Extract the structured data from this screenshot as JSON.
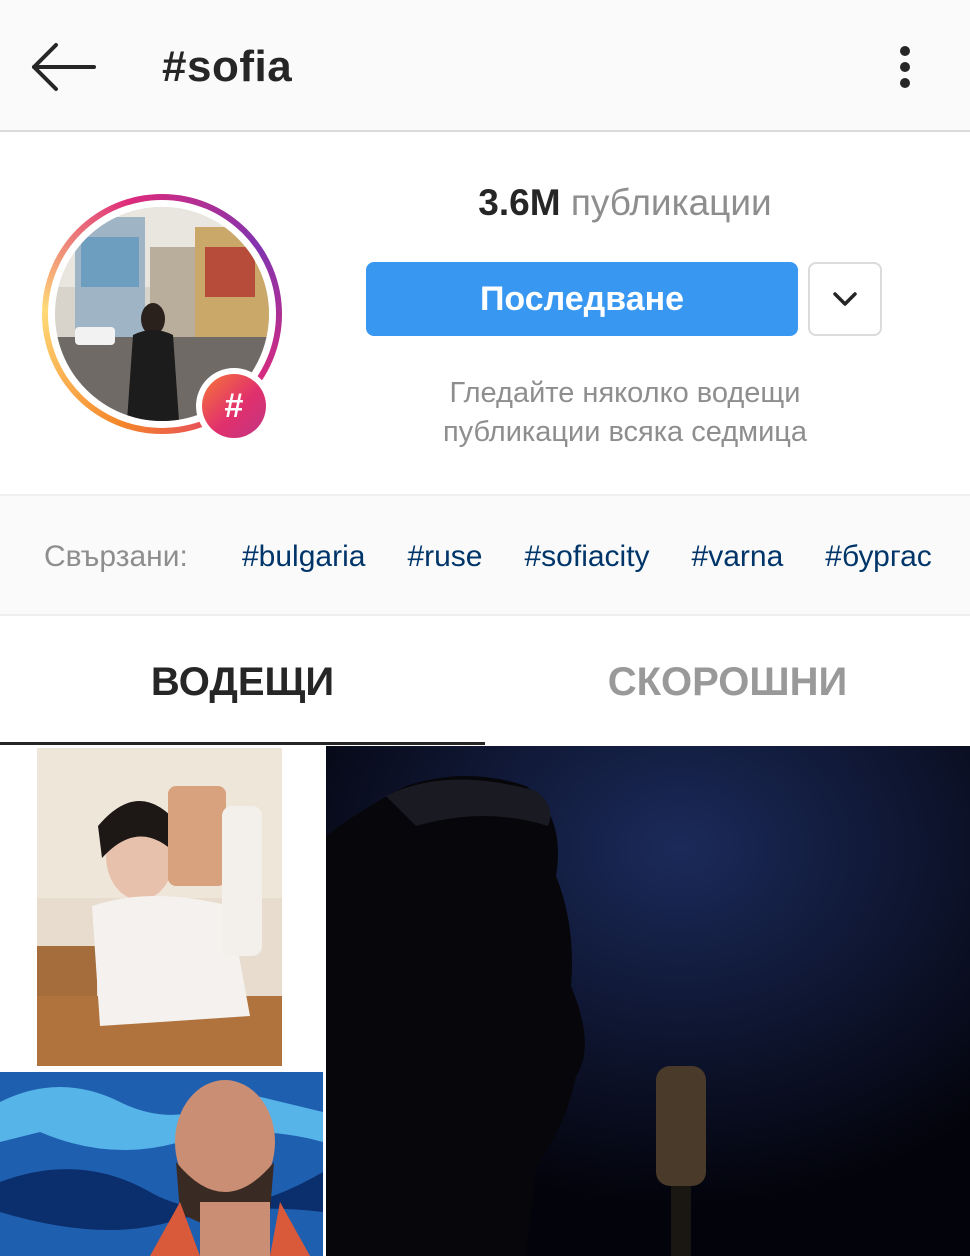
{
  "header": {
    "title": "#sofia",
    "back_icon": "back-arrow-icon",
    "more_icon": "more-vertical-icon"
  },
  "profile": {
    "posts_count": "3.6M",
    "posts_label": "публикации",
    "follow_label": "Последване",
    "dropdown_icon": "chevron-down-icon",
    "hint_line1": "Гледайте няколко водещи",
    "hint_line2": "публикации всяка седмица",
    "badge_symbol": "#"
  },
  "related": {
    "label": "Свързани:",
    "tags": [
      "#bulgaria",
      "#ruse",
      "#sofiacity",
      "#varna",
      "#бургас"
    ]
  },
  "tabs": {
    "top_label": "ВОДЕЩИ",
    "recent_label": "СКОРОШНИ"
  },
  "colors": {
    "accent_blue": "#3897f0",
    "tag_blue": "#003569",
    "muted_gray": "#8e8e8e"
  }
}
